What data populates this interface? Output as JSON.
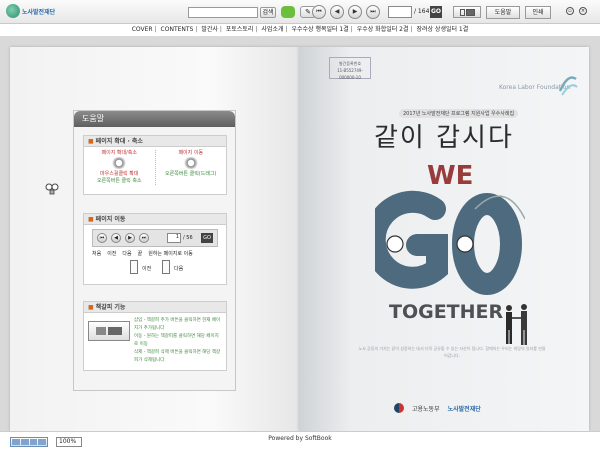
{
  "toolbar": {
    "logo_text": "노사발전재단",
    "search_placeholder": "",
    "search_label": "검색",
    "page_current": "",
    "page_total": "/ 164",
    "go_label": "GO",
    "view_label": "",
    "help_label": "도움말",
    "print_label": "인쇄",
    "nav_first": "⏮",
    "nav_prev": "◀",
    "nav_next": "▶",
    "nav_last": "⏭"
  },
  "menu": [
    "COVER",
    "CONTENTS",
    "발간사",
    "포토스토리",
    "사업소개",
    "우수수상 행복일터 1결",
    "우수상 화합일터 2결",
    "장려상 상생일터 1결"
  ],
  "help": {
    "title": "도움말",
    "sec1": {
      "heading": "페이지 확대 · 축소",
      "left_title": "페이지 확대/축소",
      "left_line1": "마우스휠클릭 확대",
      "left_line2": "오른쪽버튼 클릭 축소",
      "right_title": "페이지 이동",
      "right_line1": "오른쪽버튼 클릭(드래그)"
    },
    "sec2": {
      "heading": "페이지 이동",
      "page_input": "1",
      "page_total": "/ 56",
      "go": "GO",
      "labels": [
        "처음",
        "이전",
        "다음",
        "끝",
        "원하는 페이지로 이동"
      ],
      "prev_label": "이전",
      "next_label": "다음"
    },
    "sec3": {
      "heading": "책갈피 기능",
      "line1": "삽입 - 책갈피 추가 버튼을 클릭하면 현재 페이지가 추가됩니다",
      "line2": "이동 - 원하는 책갈피를 클릭하면 해당 페이지로 이동",
      "line3": "삭제 - 책갈피 삭제 버튼을 클릭하면 해당 책갈피가 삭제됩니다"
    }
  },
  "cover": {
    "tag_line1": "발간등록번호",
    "tag_line2": "11-B552749-000000-10",
    "org_en": "Korea Labor Foundation",
    "banner": "2017년 노사발전재단 프로그램 지원사업 우수사례집",
    "title": "같이 갑시다",
    "we": "WE",
    "go": "GO",
    "together": "TOGETHER",
    "fine_text": "노사 공동의 가치는 같이 성장하는 데서 더욱 공유할 수 있는 자산이 됩니다. 함께하는 우리는 희망의 일터를 만들어갑니다.",
    "ministry": "고용노동부",
    "foundation": "노사발전재단"
  },
  "bottom": {
    "zoom": "100%",
    "powered": "Powered by SoftBook"
  },
  "colors": {
    "go_letters": "#4d6a7e",
    "we_color": "#9a3b3b",
    "help_title_bg": "#6f6f6f"
  }
}
